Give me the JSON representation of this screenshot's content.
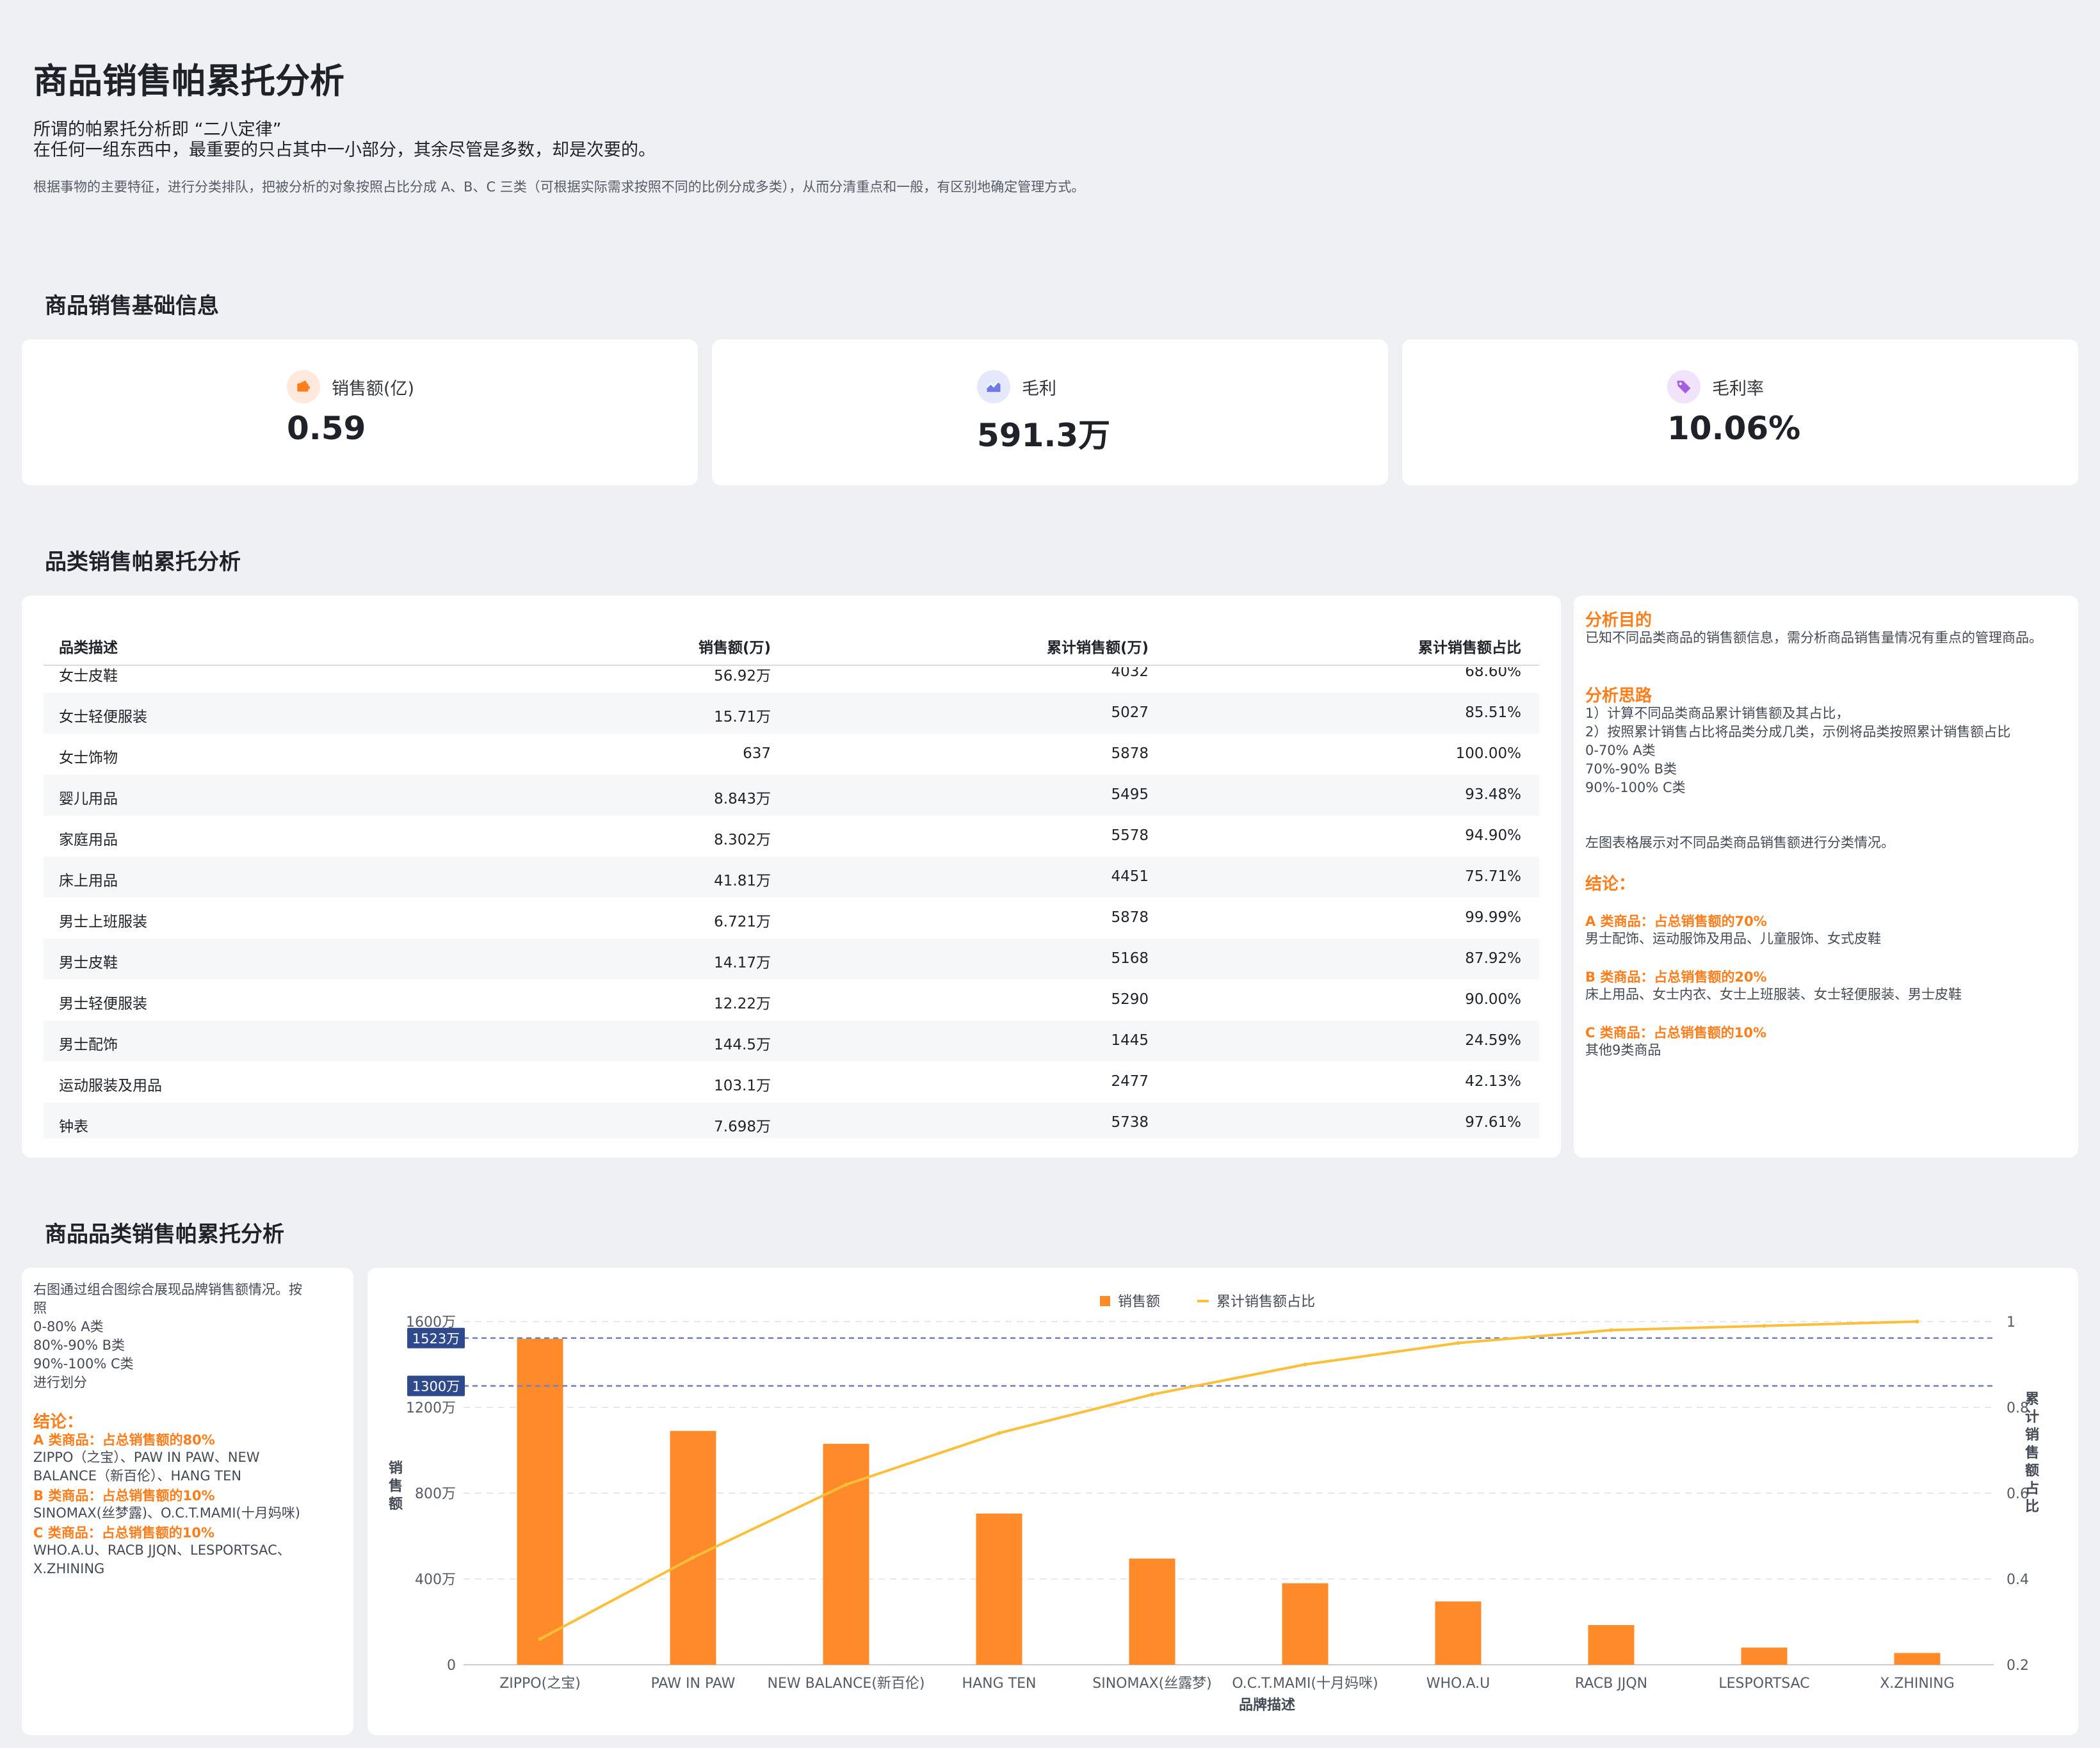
{
  "header": {
    "title": "商品销售帕累托分析",
    "intro_line1": "所谓的帕累托分析即 “二八定律”",
    "intro_line2": "在任何一组东西中，最重要的只占其中一小部分，其余尽管是多数，却是次要的。",
    "intro_desc": "根据事物的主要特征，进行分类排队，把被分析的对象按照占比分成 A、B、C 三类（可根据实际需求按照不同的比例分成多类），从而分清重点和一般，有区别地确定管理方式。"
  },
  "sections": {
    "basic": "商品销售基础信息",
    "category": "品类销售帕累托分析",
    "brand": "商品品类销售帕累托分析"
  },
  "kpis": [
    {
      "label": "销售额(亿)",
      "value": "0.59",
      "icon": "wallet-icon",
      "color": "#ff7d1a",
      "bg": "#ffe9dc"
    },
    {
      "label": "毛利",
      "value": "591.3万",
      "icon": "trend-chart-icon",
      "color": "#6c7be6",
      "bg": "#e5e8fb"
    },
    {
      "label": "毛利率",
      "value": "10.06%",
      "icon": "tag-icon",
      "color": "#a55ee6",
      "bg": "#f1e3fb"
    }
  ],
  "table": {
    "headers": [
      "品类描述",
      "销售额(万)",
      "累计销售额(万)",
      "累计销售额占比"
    ],
    "rows": [
      [
        "女士皮鞋",
        "56.92万",
        "4032",
        "68.60%"
      ],
      [
        "女士轻便服装",
        "15.71万",
        "5027",
        "85.51%"
      ],
      [
        "女士饰物",
        "637",
        "5878",
        "100.00%"
      ],
      [
        "婴儿用品",
        "8.843万",
        "5495",
        "93.48%"
      ],
      [
        "家庭用品",
        "8.302万",
        "5578",
        "94.90%"
      ],
      [
        "床上用品",
        "41.81万",
        "4451",
        "75.71%"
      ],
      [
        "男士上班服装",
        "6.721万",
        "5878",
        "99.99%"
      ],
      [
        "男士皮鞋",
        "14.17万",
        "5168",
        "87.92%"
      ],
      [
        "男士轻便服装",
        "12.22万",
        "5290",
        "90.00%"
      ],
      [
        "男士配饰",
        "144.5万",
        "1445",
        "24.59%"
      ],
      [
        "运动服装及用品",
        "103.1万",
        "2477",
        "42.13%"
      ],
      [
        "钟表",
        "7.698万",
        "5738",
        "97.61%"
      ]
    ]
  },
  "analysis": {
    "purpose_title": "分析目的",
    "purpose_text": "已知不同品类商品的销售额信息，需分析商品销售量情况有重点的管理商品。",
    "method_title": "分析思路",
    "method_lines": [
      "1）计算不同品类商品累计销售额及其占比，",
      "2）按照累计销售占比将品类分成几类，示例将品类按照累计销售额占比",
      "0-70% A类",
      "70%-90% B类",
      "90%-100% C类"
    ],
    "table_note": "左图表格展示对不同品类商品销售额进行分类情况。",
    "conclusion_title": "结论：",
    "a_title": "A 类商品：占总销售额的70%",
    "a_text": "男士配饰、运动服饰及用品、儿童服饰、女式皮鞋",
    "b_title": "B 类商品：占总销售额的20%",
    "b_text": "床上用品、女士内衣、女士上班服装、女士轻便服装、男士皮鞋",
    "c_title": "C 类商品：占总销售额的10%",
    "c_text": "其他9类商品"
  },
  "brand_note": {
    "lines": [
      "右图通过组合图综合展现品牌销售额情况。按",
      "照",
      "0-80% A类",
      "80%-90% B类",
      "90%-100% C类",
      "进行划分"
    ],
    "conclusion_title": "结论：",
    "a_title": "A 类商品：占总销售额的80%",
    "a_lines": [
      "ZIPPO（之宝）、PAW IN PAW、NEW",
      "BALANCE（新百伦）、HANG TEN"
    ],
    "b_title": "B 类商品：占总销售额的10%",
    "b_lines": [
      "SINOMAX(丝梦露)、O.C.T.MAMI(十月妈咪)"
    ],
    "c_title": "C 类商品：占总销售额的10%",
    "c_lines": [
      "WHO.A.U、RACB JJQN、LESPORTSAC、",
      "X.ZHINING"
    ]
  },
  "chart_data": {
    "type": "bar",
    "categories": [
      "ZIPPO(之宝)",
      "PAW IN PAW",
      "NEW BALANCE(新百伦)",
      "HANG TEN",
      "SINOMAX(丝露梦)",
      "O.C.T.MAMI(十月妈咪)",
      "WHO.A.U",
      "RACB JJQN",
      "LESPORTSAC",
      "X.ZHINING"
    ],
    "series": [
      {
        "name": "销售额",
        "type": "bar",
        "axis": "left",
        "color": "#ff8a2a",
        "values": [
          1520,
          1090,
          1030,
          705,
          495,
          380,
          295,
          185,
          80,
          55
        ]
      },
      {
        "name": "累计销售额占比",
        "type": "line",
        "axis": "right",
        "color": "#fbbf3a",
        "values": [
          0.26,
          0.45,
          0.62,
          0.74,
          0.83,
          0.9,
          0.95,
          0.98,
          0.99,
          1.0
        ]
      }
    ],
    "xlabel": "品牌描述",
    "ylabel": "销售额",
    "ylabel_right": "累计销售额占比",
    "ylim": [
      0,
      1600
    ],
    "ylim_right": [
      0.2,
      1
    ],
    "yticks": [
      0,
      400,
      800,
      1200,
      1600
    ],
    "ytick_labels": [
      "0",
      "400万",
      "800万",
      "1200万",
      "1600万"
    ],
    "yticks_right": [
      0.2,
      0.4,
      0.6,
      0.8,
      1
    ],
    "ytick_labels_right": [
      "0.2",
      "0.4",
      "0.6",
      "0.8",
      "1"
    ],
    "reference_lines": [
      {
        "value": 1523,
        "label": "1523万"
      },
      {
        "value": 1300,
        "label": "1300万"
      }
    ],
    "legend_position": "top",
    "grid": true
  }
}
